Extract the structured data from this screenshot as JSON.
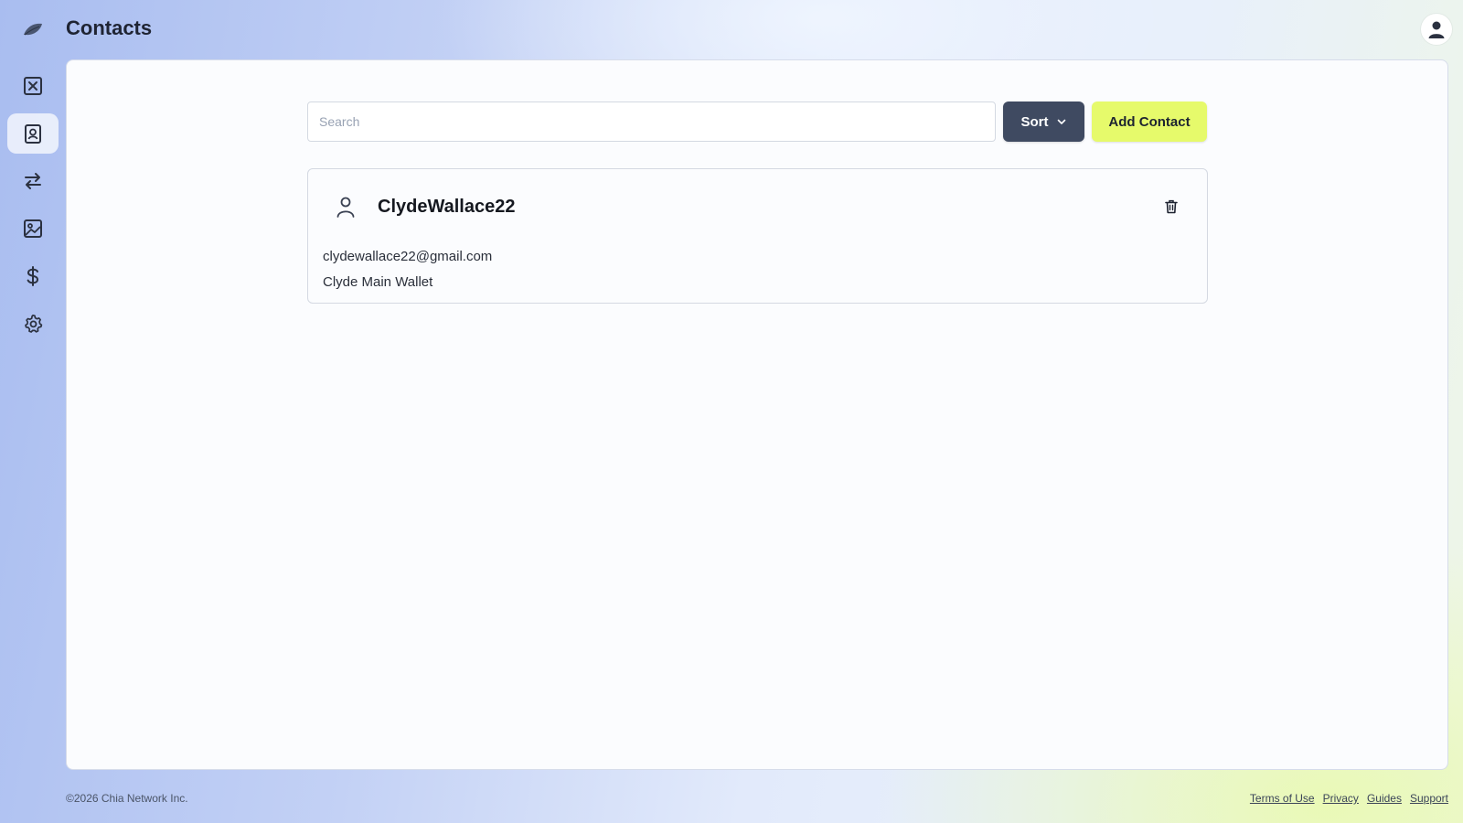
{
  "app": {
    "page_title": "Contacts"
  },
  "sidebar": {
    "items": [
      {
        "icon": "close-box-icon",
        "active": false
      },
      {
        "icon": "contacts-icon",
        "active": true
      },
      {
        "icon": "transfer-arrows-icon",
        "active": false
      },
      {
        "icon": "image-icon",
        "active": false
      },
      {
        "icon": "dollar-icon",
        "active": false
      },
      {
        "icon": "gear-icon",
        "active": false
      }
    ]
  },
  "toolbar": {
    "search_placeholder": "Search",
    "search_value": "",
    "sort_label": "Sort",
    "add_contact_label": "Add Contact"
  },
  "contacts": [
    {
      "name": "ClydeWallace22",
      "email": "clydewallace22@gmail.com",
      "wallet": "Clyde Main Wallet"
    }
  ],
  "footer": {
    "copyright": "©2026 Chia Network Inc.",
    "links": [
      "Terms of Use",
      "Privacy",
      "Guides",
      "Support"
    ]
  },
  "colors": {
    "sort_button": "#3f4a61",
    "add_button": "#e6fa6b",
    "panel": "#fbfcfe"
  }
}
